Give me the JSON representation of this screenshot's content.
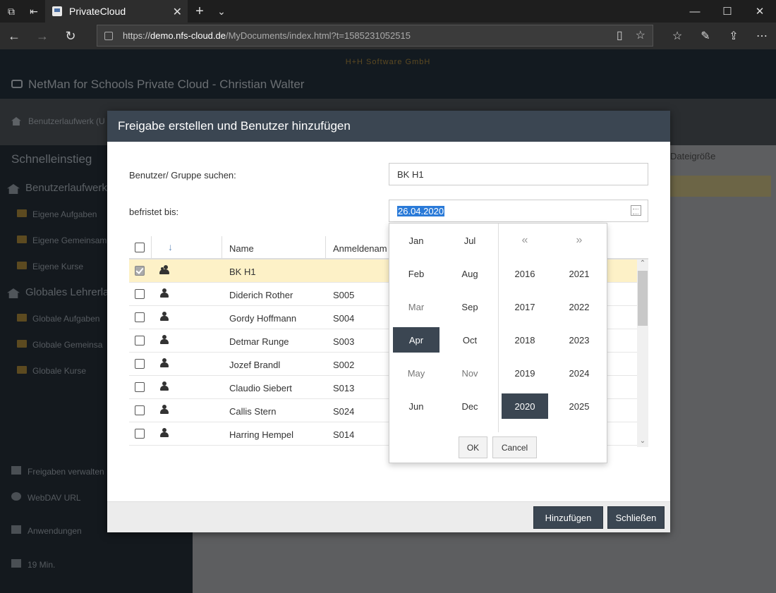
{
  "browser": {
    "tab_title": "PrivateCloud",
    "url_prefix": "https://",
    "url_domain": "demo.nfs-cloud.de",
    "url_path": "/MyDocuments/index.html?t=1585231052515"
  },
  "app": {
    "company": "H+H Software GmbH",
    "title": "NetMan for Schools Private Cloud - Christian Walter",
    "breadcrumb": "Benutzerlaufwerk (U",
    "column_hint": "Dateigröße"
  },
  "sidebar": {
    "title": "Schnelleinstieg",
    "sections": [
      {
        "label": "Benutzerlaufwerk",
        "items": [
          "Eigene Aufgaben",
          "Eigene Gemeinsam",
          "Eigene Kurse"
        ]
      },
      {
        "label": "Globales Lehrerla",
        "items": [
          "Globale Aufgaben",
          "Globale Gemeinsa",
          "Globale Kurse"
        ]
      }
    ],
    "footer": [
      "Freigaben verwalten",
      "WebDAV URL",
      "Anwendungen",
      "19 Min."
    ]
  },
  "modal": {
    "title": "Freigabe erstellen und Benutzer hinzufügen",
    "search_label": "Benutzer/ Gruppe suchen:",
    "search_value": "BK H1",
    "expiry_label": "befristet bis:",
    "expiry_value": "26.04.2020",
    "columns": [
      "Name",
      "Anmeldenam"
    ],
    "rows": [
      {
        "name": "BK H1",
        "login": "",
        "type": "group",
        "checked": true
      },
      {
        "name": "Diderich Rother",
        "login": "S005",
        "type": "user",
        "checked": false
      },
      {
        "name": "Gordy Hoffmann",
        "login": "S004",
        "type": "user",
        "checked": false
      },
      {
        "name": "Detmar Runge",
        "login": "S003",
        "type": "user",
        "checked": false
      },
      {
        "name": "Jozef Brandl",
        "login": "S002",
        "type": "user",
        "checked": false
      },
      {
        "name": "Claudio Siebert",
        "login": "S013",
        "type": "user",
        "checked": false
      },
      {
        "name": "Callis Stern",
        "login": "S024",
        "type": "user",
        "checked": false
      },
      {
        "name": "Harring Hempel",
        "login": "S014",
        "type": "user",
        "checked": false
      }
    ],
    "add_button": "Hinzufügen",
    "close_button": "Schließen"
  },
  "picker": {
    "months": [
      "Jan",
      "Jul",
      "Feb",
      "Aug",
      "Mar",
      "Sep",
      "Apr",
      "Oct",
      "May",
      "Nov",
      "Jun",
      "Dec"
    ],
    "selected_month": "Apr",
    "prev": "«",
    "next": "»",
    "years": [
      "2016",
      "2021",
      "2017",
      "2022",
      "2018",
      "2023",
      "2019",
      "2024",
      "2020",
      "2025"
    ],
    "selected_year": "2020",
    "ok": "OK",
    "cancel": "Cancel"
  }
}
